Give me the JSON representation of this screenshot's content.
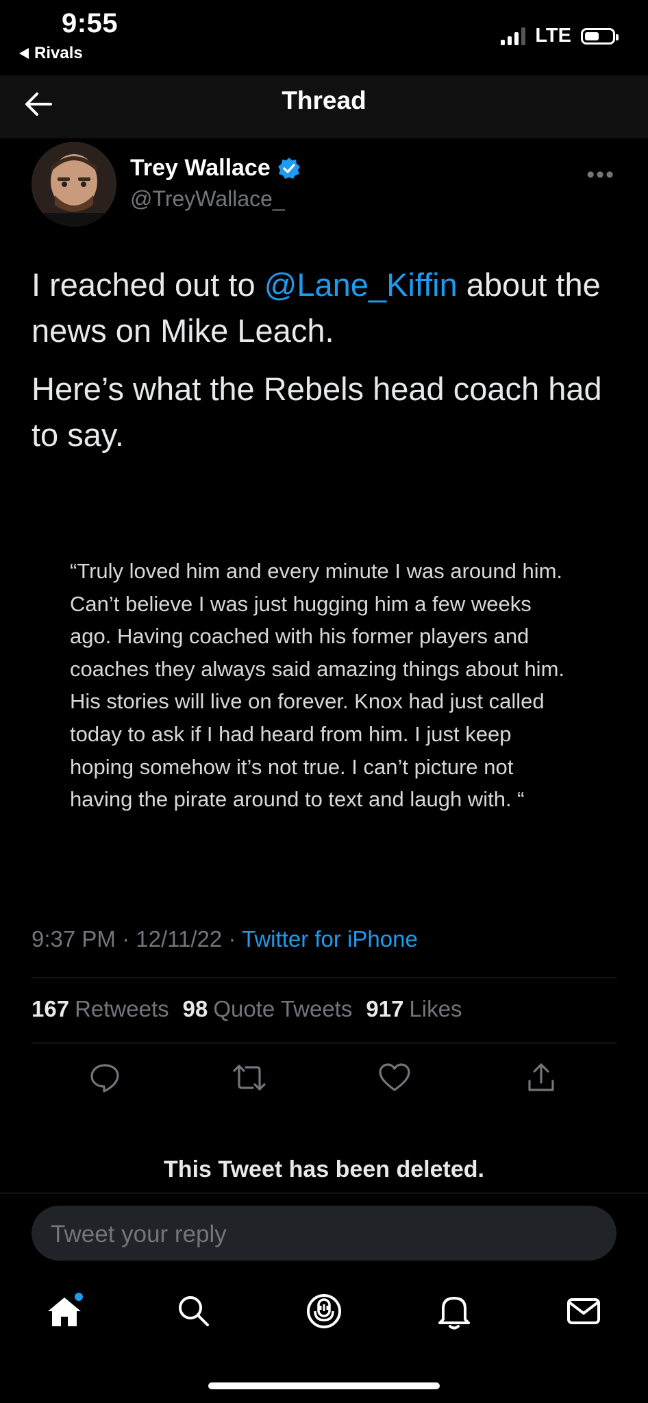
{
  "status_bar": {
    "time": "9:55",
    "back_app": "Rivals",
    "network": "LTE"
  },
  "header": {
    "title": "Thread"
  },
  "tweet": {
    "author_name": "Trey Wallace",
    "author_handle": "@TreyWallace_",
    "text_part1_prefix": "I reached out to ",
    "mention": "@Lane_Kiffin",
    "text_part1_suffix": " about the news on Mike Leach.",
    "text_part2": "Here’s what the Rebels head coach had to say.",
    "quote": "“Truly loved him and every minute I was around him. Can’t believe I was just hugging him a few weeks ago. Having coached with his former players and coaches they always said amazing things about him. His stories will live on forever. Knox had just called today to ask if I had heard from him. I just keep hoping somehow it’s not true. I can’t picture not having the pirate around to text and laugh with. “",
    "time": "9:37 PM",
    "date": "12/11/22",
    "separator": "·",
    "source": "Twitter for iPhone",
    "stats": {
      "retweets_count": "167",
      "retweets_label": "Retweets",
      "quotes_count": "98",
      "quotes_label": "Quote Tweets",
      "likes_count": "917",
      "likes_label": "Likes"
    }
  },
  "deleted_notice": "This Tweet has been deleted.",
  "reply": {
    "placeholder": "Tweet your reply"
  },
  "tab_bar": [
    "home-icon",
    "search-icon",
    "spaces-icon",
    "notifications-icon",
    "messages-icon"
  ],
  "colors": {
    "background": "#000000",
    "accent": "#1d9bf0",
    "muted": "#71767b",
    "text": "#e7e9ea"
  }
}
